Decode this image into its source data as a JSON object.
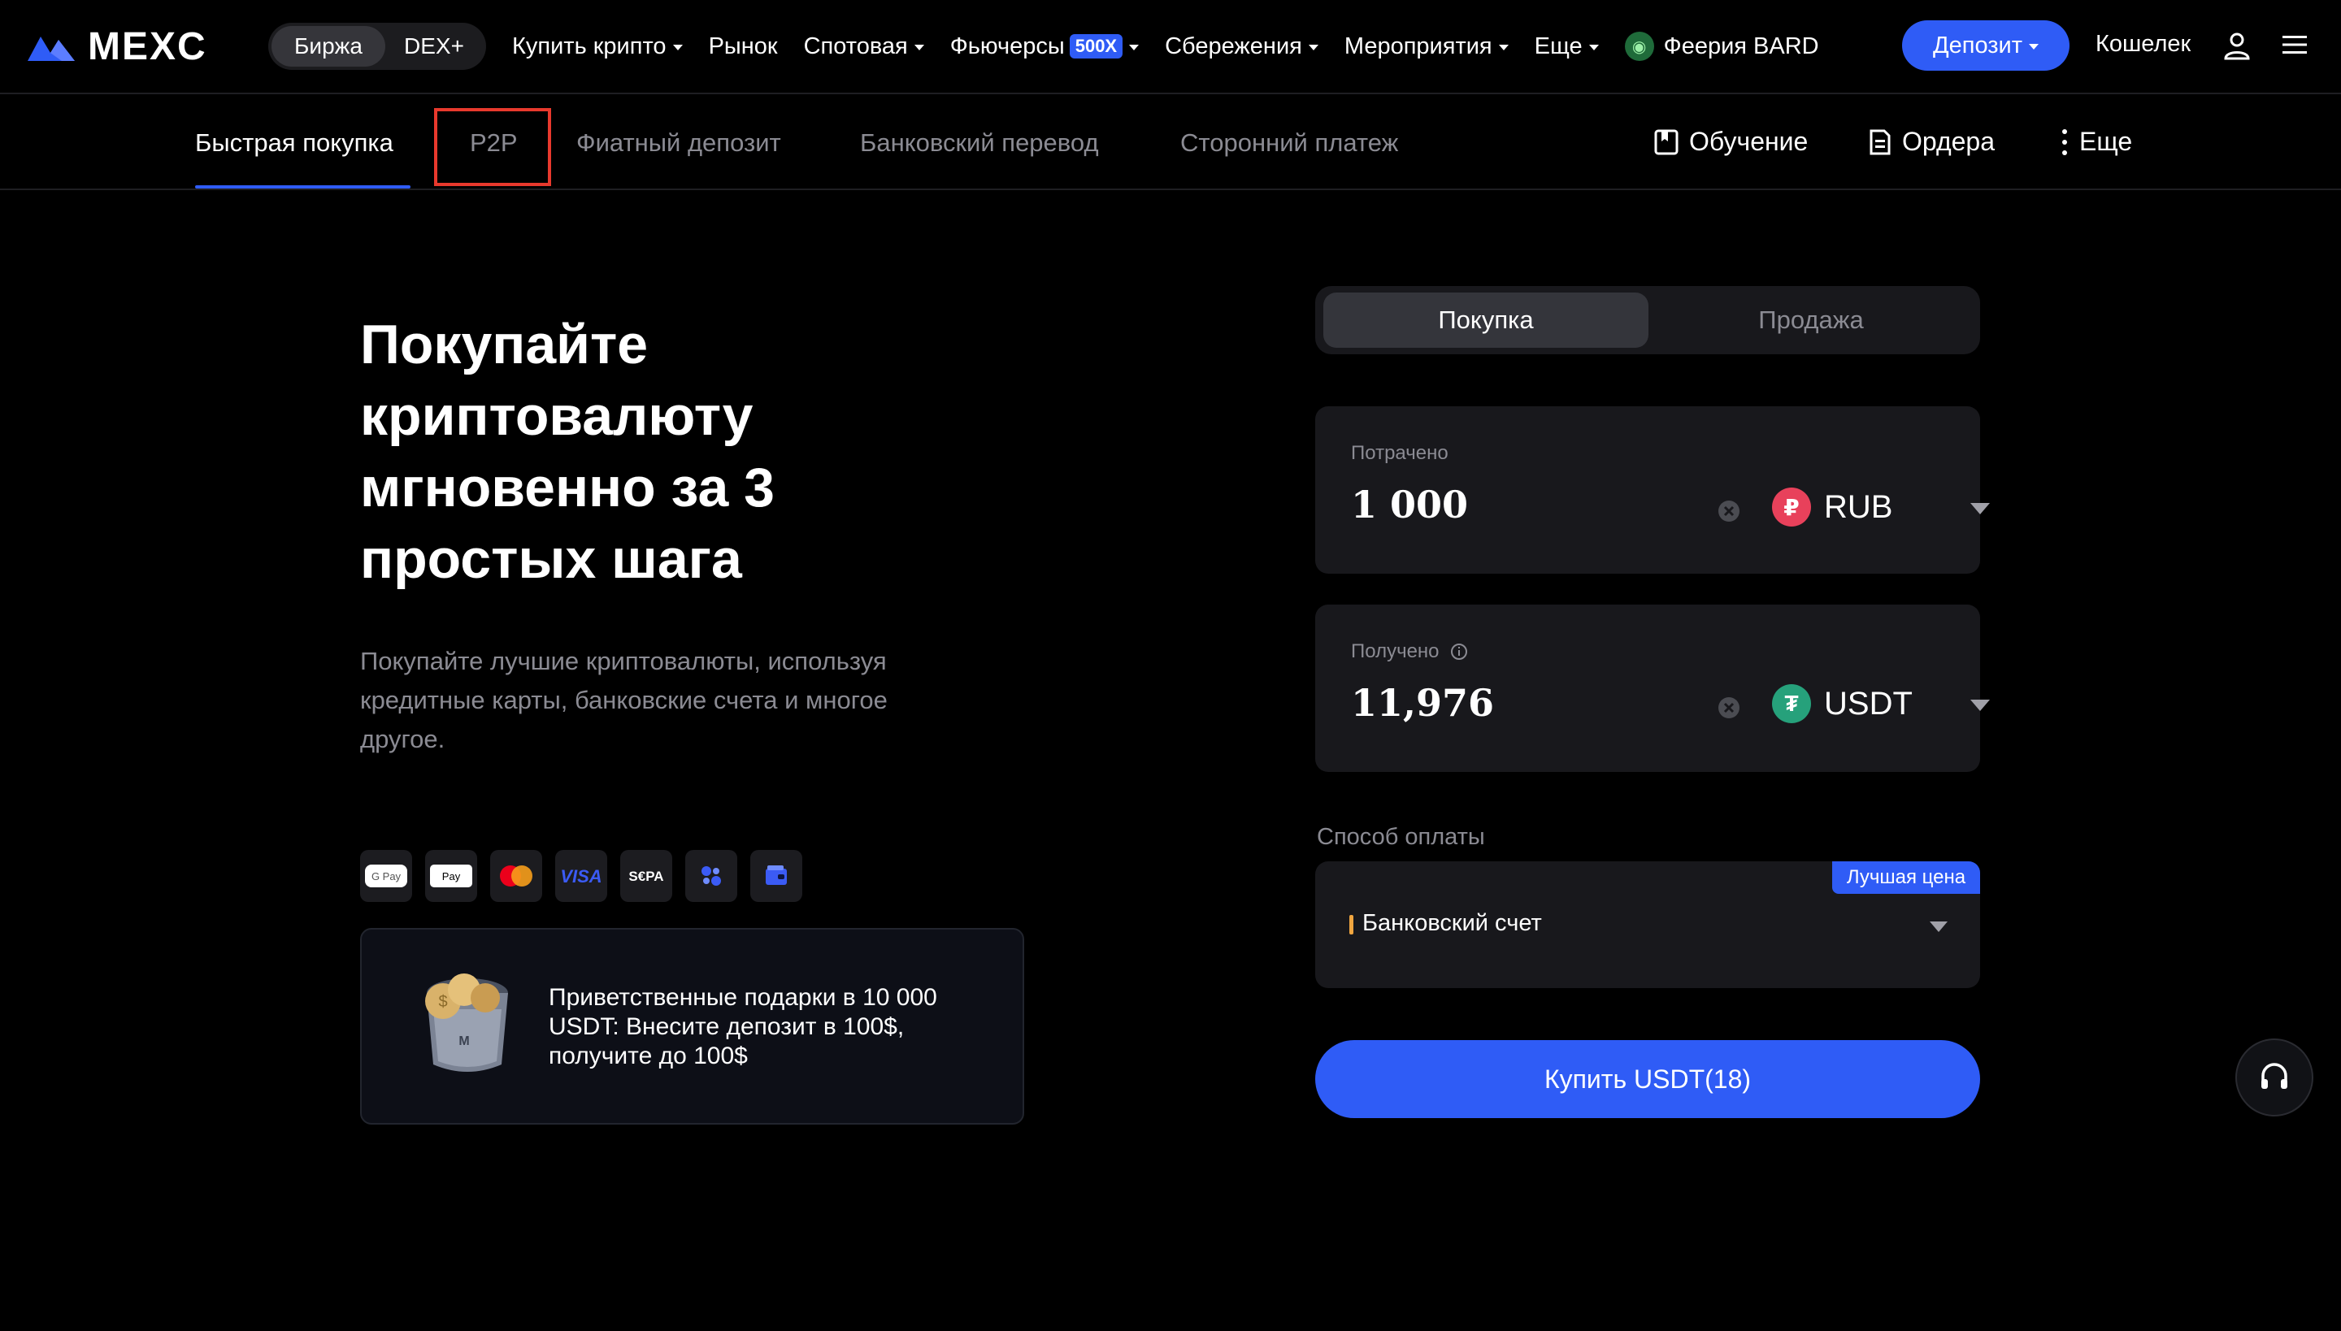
{
  "brand": {
    "name": "MEXC"
  },
  "topnav": {
    "segment": [
      "Биржа",
      "DEX+"
    ],
    "links": [
      {
        "label": "Купить крипто",
        "dropdown": true
      },
      {
        "label": "Рынок",
        "dropdown": false
      },
      {
        "label": "Спотовая",
        "dropdown": true
      },
      {
        "label": "Фьючерсы",
        "dropdown": true,
        "badge": "500X"
      },
      {
        "label": "Сбережения",
        "dropdown": true
      },
      {
        "label": "Мероприятия",
        "dropdown": true
      },
      {
        "label": "Еще",
        "dropdown": true
      }
    ],
    "event": "Феерия BARD",
    "deposit": "Депозит",
    "wallet": "Кошелек"
  },
  "subnav": {
    "tabs": [
      "Быстрая покупка",
      "P2P",
      "Фиатный депозит",
      "Банковский перевод",
      "Сторонний платеж"
    ],
    "active_index": 0,
    "right": [
      "Обучение",
      "Ордера",
      "Еще"
    ]
  },
  "hero": {
    "title": "Покупайте криптовалюту мгновенно за 3 простых шага",
    "subtitle": "Покупайте лучшие криптовалюты, используя кредитные карты, банковские счета и многое другое."
  },
  "payment_logos": [
    "google-pay",
    "apple-pay",
    "mastercard",
    "visa",
    "sepa",
    "pay-icon",
    "wallet-icon"
  ],
  "promo": {
    "text": "Приветственные подарки в 10 000 USDT: Внесите депозит в 100$, получите до 100$"
  },
  "trade": {
    "tabs": [
      "Покупка",
      "Продажа"
    ],
    "spent": {
      "label": "Потрачено",
      "value": "1 000",
      "currency": "RUB",
      "currency_symbol": "₽"
    },
    "received": {
      "label": "Получено",
      "value": "11,976",
      "currency": "USDT",
      "currency_symbol": "₮"
    },
    "payment": {
      "label": "Способ оплаты",
      "badge": "Лучшая цена",
      "value": "Банковский счет"
    },
    "buy_button": "Купить USDT(18)"
  },
  "colors": {
    "accent": "#2f5cf6",
    "highlight_box": "#e8392d",
    "rub": "#e8415b",
    "usdt": "#26a17b"
  }
}
